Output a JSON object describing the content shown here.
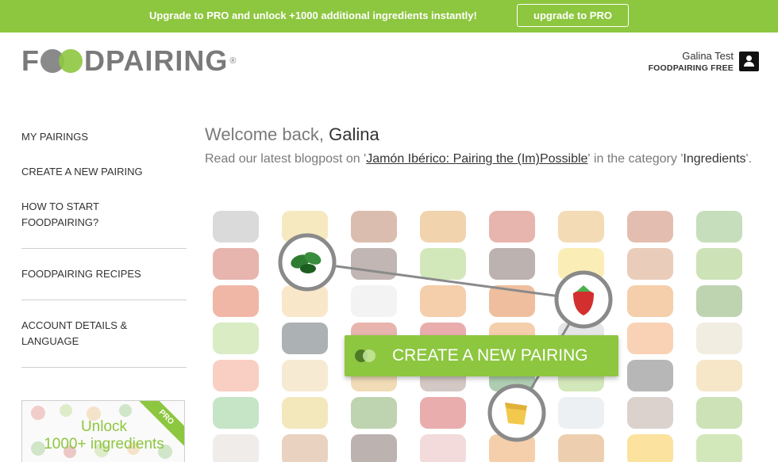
{
  "banner": {
    "message": "Upgrade to PRO and unlock +1000 additional ingredients instantly!",
    "button_label": "upgrade to PRO",
    "color": "#8dc63f"
  },
  "header": {
    "logo": {
      "text_left": "F",
      "text_right": "DPAIRING",
      "registered": "®"
    },
    "user": {
      "name": "Galina Test",
      "plan": "FOODPAIRING FREE",
      "icon": "user-icon"
    }
  },
  "sidebar": {
    "items": [
      {
        "id": "my-pairings",
        "line1": "MY PAIRINGS",
        "line2": ""
      },
      {
        "id": "create-new-pairing",
        "line1": "CREATE A NEW PAIRING",
        "line2": ""
      },
      {
        "id": "how-to-start",
        "line1": "HOW TO START",
        "line2": "FOODPAIRING?"
      },
      {
        "id": "recipes",
        "line1": "FOODPAIRING RECIPES",
        "line2": ""
      },
      {
        "id": "account",
        "line1": "ACCOUNT DETAILS &",
        "line2": "LANGUAGE"
      }
    ],
    "unlock": {
      "line1": "Unlock",
      "line2": "1000+ ingredients",
      "ribbon": "PRO"
    }
  },
  "main": {
    "welcome_prefix": "Welcome back, ",
    "welcome_name": "Galina",
    "blog_prefix": "Read our latest blogpost on '",
    "blog_link": "Jamón Ibérico: Pairing the (Im)Possible",
    "blog_middle": "' in the category '",
    "blog_category": "Ingredients",
    "blog_suffix": "'.",
    "cta_label": "CREATE A NEW PAIRING",
    "cta_icon": "pairing-circles-icon",
    "highlighted_ingredients": [
      "spinach-icon",
      "strawberry-icon",
      "cheese-icon"
    ]
  },
  "colors": {
    "accent": "#8dc63f",
    "text_dark": "#333333",
    "text_muted": "#7a7a7a"
  }
}
